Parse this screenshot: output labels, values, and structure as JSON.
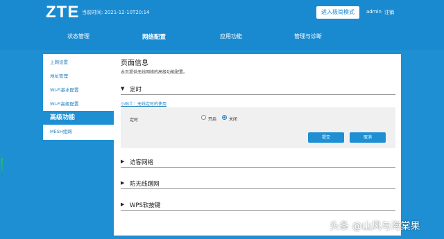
{
  "header": {
    "logo": "ZTE",
    "time_label": "当前时间:",
    "time_value": "2021-12-10T20:14",
    "advanced_button": "进入极简模式",
    "user": "admin",
    "logout": "注销"
  },
  "nav": {
    "items": [
      {
        "label": "状态管理"
      },
      {
        "label": "网络配置",
        "active": true
      },
      {
        "label": "应用功能"
      },
      {
        "label": "管理与诊断"
      }
    ]
  },
  "sidebar": {
    "items": [
      {
        "label": "上网设置"
      },
      {
        "label": "地址管理"
      },
      {
        "label": "Wi-Fi基本配置"
      },
      {
        "label": "Wi-Fi高级配置"
      },
      {
        "label": "高级功能",
        "active": true
      },
      {
        "label": "MESH组网"
      }
    ]
  },
  "main": {
    "title": "页面信息",
    "description": "本页提供无线网络的高级功能配置。",
    "sections": [
      {
        "label": "定时",
        "expanded": true
      },
      {
        "label": "访客网络",
        "expanded": false
      },
      {
        "label": "防无线蹭网",
        "expanded": false
      },
      {
        "label": "WPS软按键",
        "expanded": false
      }
    ],
    "tip_link": "小贴士：无线定时的使用",
    "timer": {
      "label": "定时",
      "option_on": "开启",
      "option_off": "关闭",
      "selected": "关闭",
      "submit": "提交",
      "cancel": "取消"
    }
  },
  "watermark": "头条 @山风与海棠果",
  "icons": {
    "expanded": "▼",
    "collapsed": "▶"
  }
}
